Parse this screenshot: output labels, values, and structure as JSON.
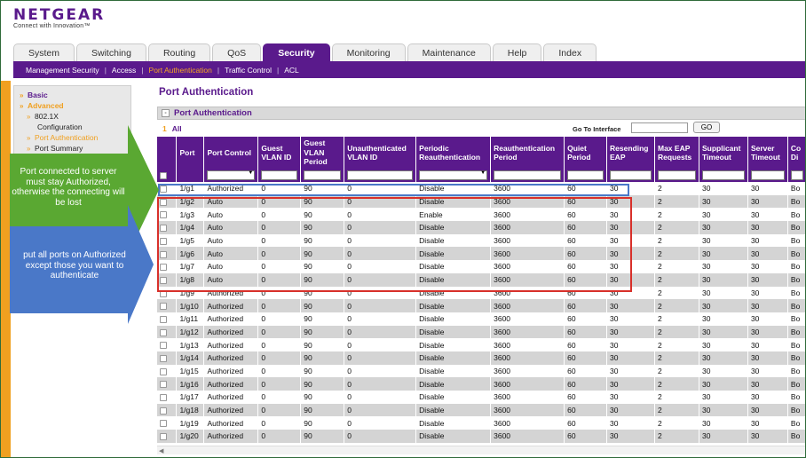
{
  "logo": {
    "text": "NETGEAR",
    "tagline": "Connect with Innovation™"
  },
  "tabs": [
    {
      "label": "System"
    },
    {
      "label": "Switching"
    },
    {
      "label": "Routing"
    },
    {
      "label": "QoS"
    },
    {
      "label": "Security",
      "active": true
    },
    {
      "label": "Monitoring"
    },
    {
      "label": "Maintenance"
    },
    {
      "label": "Help"
    },
    {
      "label": "Index"
    }
  ],
  "subnav": [
    {
      "label": "Management Security"
    },
    {
      "label": "Access"
    },
    {
      "label": "Port Authentication",
      "active": true
    },
    {
      "label": "Traffic Control"
    },
    {
      "label": "ACL"
    }
  ],
  "sidebar": {
    "items": [
      {
        "label": "Basic",
        "arrow": "»"
      },
      {
        "label": "Advanced",
        "arrow": "»"
      },
      {
        "label": "802.1X",
        "arrow": "»"
      },
      {
        "label": "Configuration"
      },
      {
        "label": "Port Authentication",
        "arrow": "»"
      },
      {
        "label": "Port Summary",
        "arrow": "»"
      }
    ]
  },
  "page": {
    "title": "Port Authentication",
    "panel_title": "Port Authentication",
    "panel_toggle": "-",
    "count": "1",
    "all_label": "All",
    "goto_label": "Go To Interface",
    "go_button": "GO"
  },
  "table": {
    "columns": [
      "",
      "Port",
      "Port Control",
      "Guest VLAN ID",
      "Guest VLAN Period",
      "Unauthenticated VLAN ID",
      "Periodic Reauthentication",
      "Reauthentication Period",
      "Quiet Period",
      "Resending EAP",
      "Max EAP Requests",
      "Supplicant Timeout",
      "Server Timeout",
      "Co Di"
    ],
    "rows": [
      [
        "1/g1",
        "Authorized",
        "0",
        "90",
        "0",
        "Disable",
        "3600",
        "60",
        "30",
        "2",
        "30",
        "30",
        "Bo"
      ],
      [
        "1/g2",
        "Auto",
        "0",
        "90",
        "0",
        "Disable",
        "3600",
        "60",
        "30",
        "2",
        "30",
        "30",
        "Bo"
      ],
      [
        "1/g3",
        "Auto",
        "0",
        "90",
        "0",
        "Enable",
        "3600",
        "60",
        "30",
        "2",
        "30",
        "30",
        "Bo"
      ],
      [
        "1/g4",
        "Auto",
        "0",
        "90",
        "0",
        "Disable",
        "3600",
        "60",
        "30",
        "2",
        "30",
        "30",
        "Bo"
      ],
      [
        "1/g5",
        "Auto",
        "0",
        "90",
        "0",
        "Disable",
        "3600",
        "60",
        "30",
        "2",
        "30",
        "30",
        "Bo"
      ],
      [
        "1/g6",
        "Auto",
        "0",
        "90",
        "0",
        "Disable",
        "3600",
        "60",
        "30",
        "2",
        "30",
        "30",
        "Bo"
      ],
      [
        "1/g7",
        "Auto",
        "0",
        "90",
        "0",
        "Disable",
        "3600",
        "60",
        "30",
        "2",
        "30",
        "30",
        "Bo"
      ],
      [
        "1/g8",
        "Auto",
        "0",
        "90",
        "0",
        "Disable",
        "3600",
        "60",
        "30",
        "2",
        "30",
        "30",
        "Bo"
      ],
      [
        "1/g9",
        "Authorized",
        "0",
        "90",
        "0",
        "Disable",
        "3600",
        "60",
        "30",
        "2",
        "30",
        "30",
        "Bo"
      ],
      [
        "1/g10",
        "Authorized",
        "0",
        "90",
        "0",
        "Disable",
        "3600",
        "60",
        "30",
        "2",
        "30",
        "30",
        "Bo"
      ],
      [
        "1/g11",
        "Authorized",
        "0",
        "90",
        "0",
        "Disable",
        "3600",
        "60",
        "30",
        "2",
        "30",
        "30",
        "Bo"
      ],
      [
        "1/g12",
        "Authorized",
        "0",
        "90",
        "0",
        "Disable",
        "3600",
        "60",
        "30",
        "2",
        "30",
        "30",
        "Bo"
      ],
      [
        "1/g13",
        "Authorized",
        "0",
        "90",
        "0",
        "Disable",
        "3600",
        "60",
        "30",
        "2",
        "30",
        "30",
        "Bo"
      ],
      [
        "1/g14",
        "Authorized",
        "0",
        "90",
        "0",
        "Disable",
        "3600",
        "60",
        "30",
        "2",
        "30",
        "30",
        "Bo"
      ],
      [
        "1/g15",
        "Authorized",
        "0",
        "90",
        "0",
        "Disable",
        "3600",
        "60",
        "30",
        "2",
        "30",
        "30",
        "Bo"
      ],
      [
        "1/g16",
        "Authorized",
        "0",
        "90",
        "0",
        "Disable",
        "3600",
        "60",
        "30",
        "2",
        "30",
        "30",
        "Bo"
      ],
      [
        "1/g17",
        "Authorized",
        "0",
        "90",
        "0",
        "Disable",
        "3600",
        "60",
        "30",
        "2",
        "30",
        "30",
        "Bo"
      ],
      [
        "1/g18",
        "Authorized",
        "0",
        "90",
        "0",
        "Disable",
        "3600",
        "60",
        "30",
        "2",
        "30",
        "30",
        "Bo"
      ],
      [
        "1/g19",
        "Authorized",
        "0",
        "90",
        "0",
        "Disable",
        "3600",
        "60",
        "30",
        "2",
        "30",
        "30",
        "Bo"
      ],
      [
        "1/g20",
        "Authorized",
        "0",
        "90",
        "0",
        "Disable",
        "3600",
        "60",
        "30",
        "2",
        "30",
        "30",
        "Bo"
      ]
    ]
  },
  "callouts": {
    "green": "Port connected to server must stay Authorized, otherwise the connecting will be lost",
    "blue": "put all ports on Authorized except those you want to authenticate"
  },
  "colors": {
    "brand_purple": "#5a1a8c",
    "accent_orange": "#f0a020",
    "callout_green": "#5aa832",
    "callout_blue": "#4a78c8",
    "highlight_blue": "#4a78c8",
    "highlight_red": "#d8302a"
  },
  "icons": {
    "dropdown": "▼",
    "checkbox": "checkbox-icon"
  }
}
